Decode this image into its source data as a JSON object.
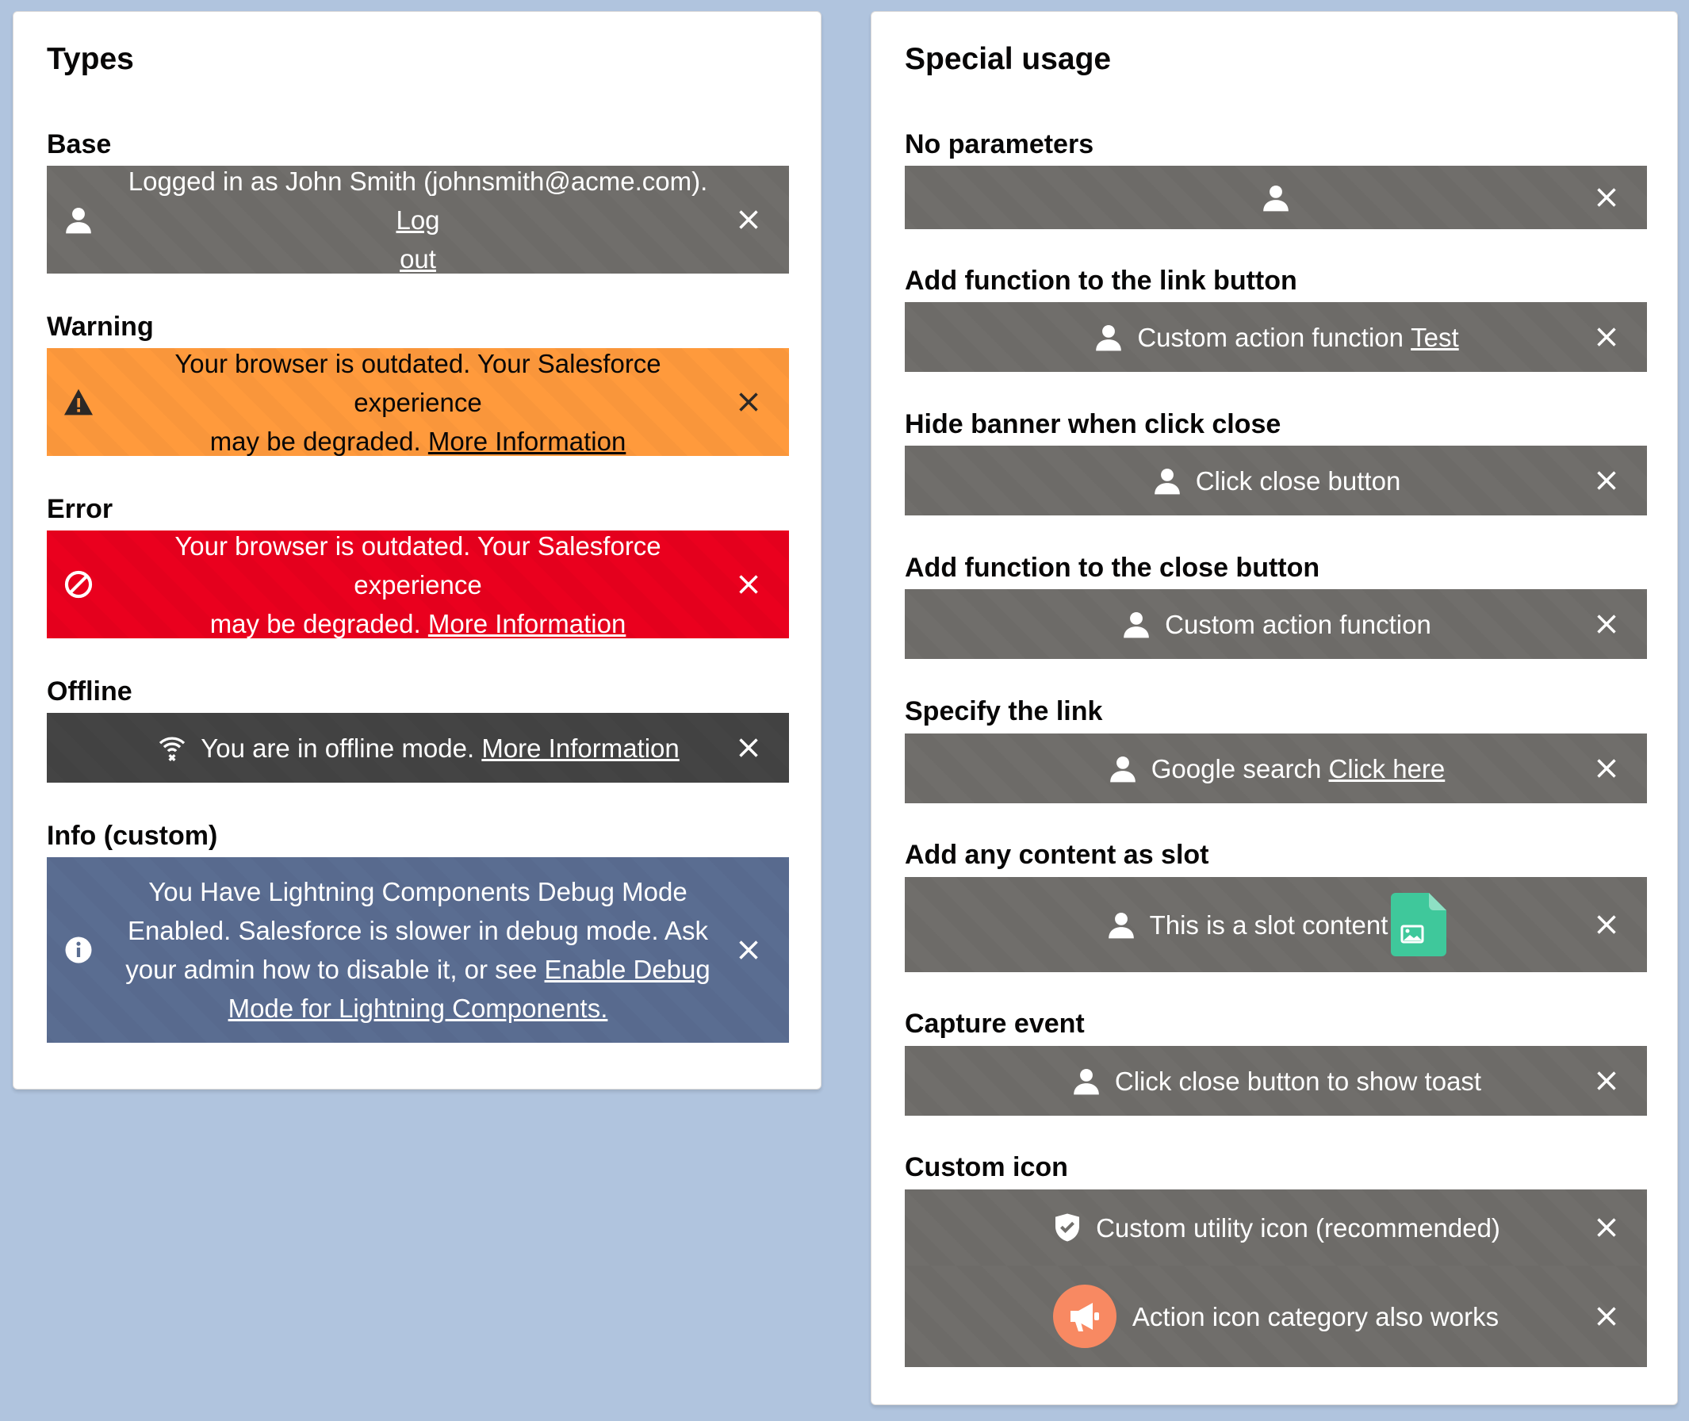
{
  "colors": {
    "page_background": "#b0c4de",
    "base_banner": "#706e6b",
    "warning_banner": "#ff9a3c",
    "error_banner": "#ea001e",
    "offline_banner": "#444444",
    "info_banner": "#5a6d91",
    "slot_icon": "#3fc89b",
    "action_icon": "#f88962"
  },
  "types": {
    "title": "Types",
    "base": {
      "label": "Base",
      "text": "Logged in as John Smith (johnsmith@acme.com).",
      "link_line1": "Log",
      "link_line2": "out",
      "icon": "user-icon"
    },
    "warning": {
      "label": "Warning",
      "line1": "Your browser is outdated. Your Salesforce experience",
      "line2": "may be degraded.",
      "link": "More Information",
      "icon": "warning-icon"
    },
    "error": {
      "label": "Error",
      "line1": "Your browser is outdated. Your Salesforce experience",
      "line2": "may be degraded.",
      "link": "More Information",
      "icon": "ban-icon"
    },
    "offline": {
      "label": "Offline",
      "text": "You are in offline mode.",
      "link": "More Information",
      "icon": "offline-icon"
    },
    "info": {
      "label": "Info (custom)",
      "line1": "You Have Lightning Components Debug Mode",
      "line2": "Enabled. Salesforce is slower in debug mode. Ask",
      "line3": "your admin how to disable it, or see",
      "link_line1": "Enable Debug",
      "link_line2": "Mode for Lightning Components.",
      "icon": "info-icon"
    }
  },
  "special": {
    "title": "Special usage",
    "no_params": {
      "label": "No parameters"
    },
    "link_fn": {
      "label": "Add function to the link button",
      "text": "Custom action function",
      "link": "Test"
    },
    "hide_banner": {
      "label": "Hide banner when click close",
      "text": "Click close button"
    },
    "close_fn": {
      "label": "Add function to the close button",
      "text": "Custom action function"
    },
    "specify_link": {
      "label": "Specify the link",
      "text": "Google search",
      "link": "Click here"
    },
    "slot": {
      "label": "Add any content as slot",
      "text": "This is a slot content"
    },
    "capture": {
      "label": "Capture event",
      "text": "Click close button to show toast"
    },
    "custom_icon": {
      "label": "Custom icon",
      "utility_text": "Custom utility icon (recommended)",
      "action_text": "Action icon category also works"
    }
  }
}
